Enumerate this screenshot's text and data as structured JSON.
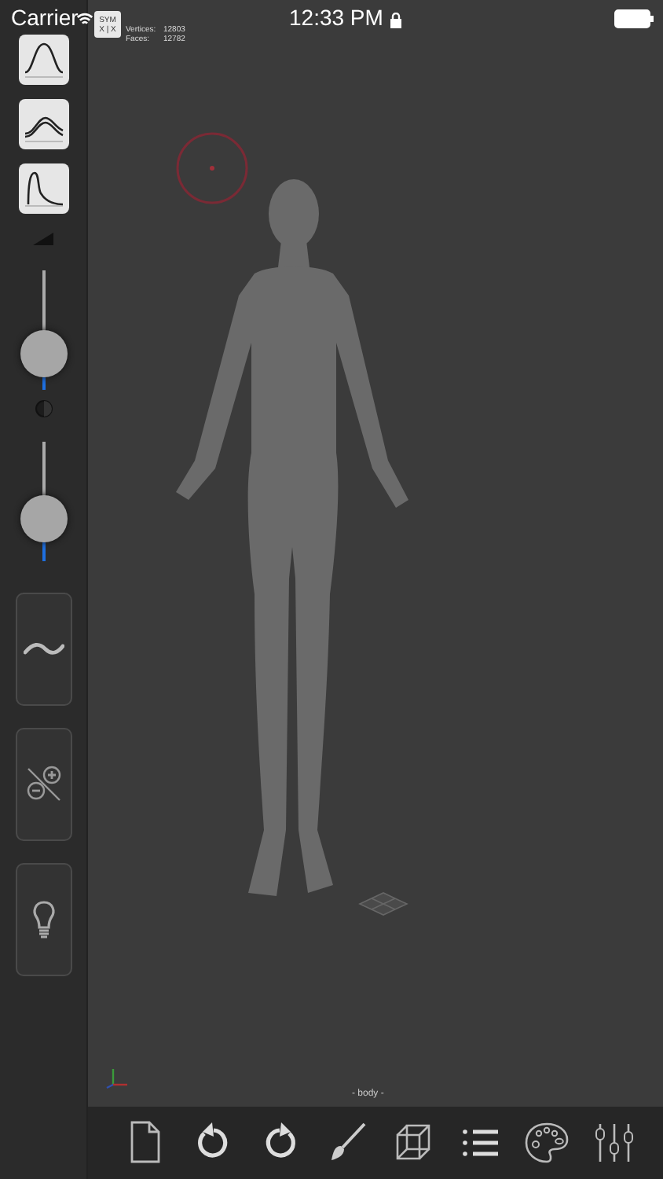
{
  "status_bar": {
    "carrier": "Carrier",
    "time": "12:33 PM"
  },
  "mesh_info": {
    "sym_button": {
      "line1": "SYM",
      "line2": "X | X"
    },
    "vertices_label": "Vertices:",
    "vertices": "12803",
    "faces_label": "Faces:",
    "faces": "12782"
  },
  "sidebar": {
    "curve_buttons": [
      {
        "kind": "bell"
      },
      {
        "kind": "wave"
      },
      {
        "kind": "peak"
      }
    ],
    "sliders": [
      {
        "kind": "size",
        "level": 0.3
      },
      {
        "kind": "intensity",
        "level": 0.36
      }
    ],
    "tool_buttons": [
      {
        "kind": "stroke"
      },
      {
        "kind": "invert"
      },
      {
        "kind": "light"
      }
    ]
  },
  "viewport": {
    "object_name": "- body -"
  },
  "toolbar": [
    {
      "kind": "new"
    },
    {
      "kind": "undo"
    },
    {
      "kind": "redo"
    },
    {
      "kind": "brush"
    },
    {
      "kind": "wireframe"
    },
    {
      "kind": "list"
    },
    {
      "kind": "palette"
    },
    {
      "kind": "settings"
    }
  ]
}
